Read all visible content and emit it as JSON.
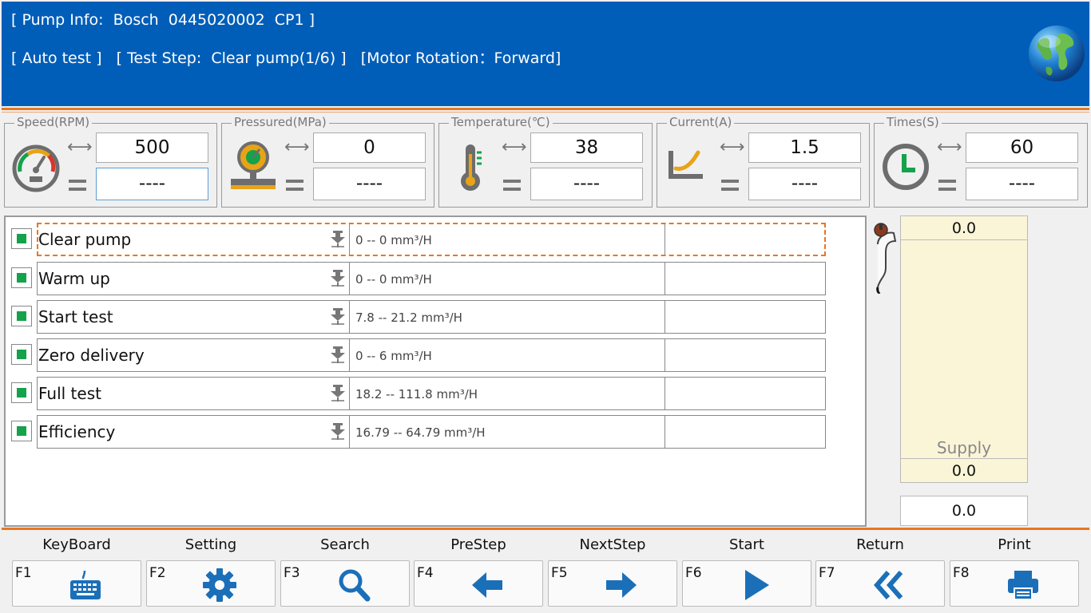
{
  "header": {
    "pump_info": "[ Pump Info:  Bosch  0445020002  CP1 ]",
    "mode": "[ Auto test ]",
    "test_step": "[ Test Step:  Clear pump(1/6) ]",
    "motor_rotation": "[Motor Rotation：Forward]",
    "globe_icon": "globe-icon",
    "colors": {
      "header_bg": "#005eb8",
      "accent": "#e87722",
      "check_green": "#14a24b",
      "icon_blue": "#1b6fb8"
    }
  },
  "gauges": [
    {
      "label": "Speed(RPM)",
      "set": "500",
      "actual": "----",
      "icon": "speedometer-icon"
    },
    {
      "label": "Pressured(MPa)",
      "set": "0",
      "actual": "----",
      "icon": "pressure-gauge-icon"
    },
    {
      "label": "Temperature(℃)",
      "set": "38",
      "actual": "----",
      "icon": "thermometer-icon"
    },
    {
      "label": "Current(A)",
      "set": "1.5",
      "actual": "----",
      "icon": "current-icon"
    },
    {
      "label": "Times(S)",
      "set": "60",
      "actual": "----",
      "icon": "clock-icon"
    }
  ],
  "steps": [
    {
      "name": "Clear pump",
      "range": "0 -- 0 mm³/H",
      "result": "",
      "checked": true,
      "active": true
    },
    {
      "name": "Warm up",
      "range": "0 -- 0 mm³/H",
      "result": "",
      "checked": true
    },
    {
      "name": "Start test",
      "range": "7.8 -- 21.2 mm³/H",
      "result": "",
      "checked": true
    },
    {
      "name": "Zero delivery",
      "range": "0 -- 6 mm³/H",
      "result": "",
      "checked": true
    },
    {
      "name": "Full test",
      "range": "18.2 -- 111.8 mm³/H",
      "result": "",
      "checked": true
    },
    {
      "name": "Efficiency",
      "range": "16.79 -- 64.79 mm³/H",
      "result": "",
      "checked": true
    }
  ],
  "supply": {
    "top_value": "0.0",
    "label": "Supply",
    "bottom_value": "0.0",
    "extra_value": "0.0"
  },
  "fkeys": [
    {
      "key": "F1",
      "label": "KeyBoard",
      "icon": "keyboard-icon"
    },
    {
      "key": "F2",
      "label": "Setting",
      "icon": "gear-icon"
    },
    {
      "key": "F3",
      "label": "Search",
      "icon": "search-icon"
    },
    {
      "key": "F4",
      "label": "PreStep",
      "icon": "arrow-left-icon"
    },
    {
      "key": "F5",
      "label": "NextStep",
      "icon": "arrow-right-icon"
    },
    {
      "key": "F6",
      "label": "Start",
      "icon": "play-icon"
    },
    {
      "key": "F7",
      "label": "Return",
      "icon": "double-chevron-left-icon"
    },
    {
      "key": "F8",
      "label": "Print",
      "icon": "printer-icon"
    }
  ]
}
